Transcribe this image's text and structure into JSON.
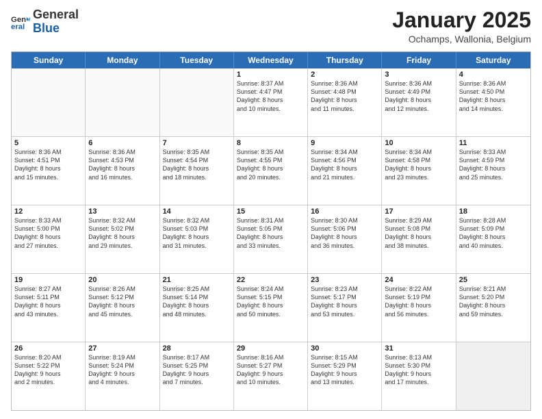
{
  "header": {
    "logo_general": "General",
    "logo_blue": "Blue",
    "month_title": "January 2025",
    "location": "Ochamps, Wallonia, Belgium"
  },
  "weekdays": [
    "Sunday",
    "Monday",
    "Tuesday",
    "Wednesday",
    "Thursday",
    "Friday",
    "Saturday"
  ],
  "rows": [
    [
      {
        "day": "",
        "text": "",
        "empty": true
      },
      {
        "day": "",
        "text": "",
        "empty": true
      },
      {
        "day": "",
        "text": "",
        "empty": true
      },
      {
        "day": "1",
        "text": "Sunrise: 8:37 AM\nSunset: 4:47 PM\nDaylight: 8 hours\nand 10 minutes.",
        "empty": false
      },
      {
        "day": "2",
        "text": "Sunrise: 8:36 AM\nSunset: 4:48 PM\nDaylight: 8 hours\nand 11 minutes.",
        "empty": false
      },
      {
        "day": "3",
        "text": "Sunrise: 8:36 AM\nSunset: 4:49 PM\nDaylight: 8 hours\nand 12 minutes.",
        "empty": false
      },
      {
        "day": "4",
        "text": "Sunrise: 8:36 AM\nSunset: 4:50 PM\nDaylight: 8 hours\nand 14 minutes.",
        "empty": false
      }
    ],
    [
      {
        "day": "5",
        "text": "Sunrise: 8:36 AM\nSunset: 4:51 PM\nDaylight: 8 hours\nand 15 minutes.",
        "empty": false
      },
      {
        "day": "6",
        "text": "Sunrise: 8:36 AM\nSunset: 4:53 PM\nDaylight: 8 hours\nand 16 minutes.",
        "empty": false
      },
      {
        "day": "7",
        "text": "Sunrise: 8:35 AM\nSunset: 4:54 PM\nDaylight: 8 hours\nand 18 minutes.",
        "empty": false
      },
      {
        "day": "8",
        "text": "Sunrise: 8:35 AM\nSunset: 4:55 PM\nDaylight: 8 hours\nand 20 minutes.",
        "empty": false
      },
      {
        "day": "9",
        "text": "Sunrise: 8:34 AM\nSunset: 4:56 PM\nDaylight: 8 hours\nand 21 minutes.",
        "empty": false
      },
      {
        "day": "10",
        "text": "Sunrise: 8:34 AM\nSunset: 4:58 PM\nDaylight: 8 hours\nand 23 minutes.",
        "empty": false
      },
      {
        "day": "11",
        "text": "Sunrise: 8:33 AM\nSunset: 4:59 PM\nDaylight: 8 hours\nand 25 minutes.",
        "empty": false
      }
    ],
    [
      {
        "day": "12",
        "text": "Sunrise: 8:33 AM\nSunset: 5:00 PM\nDaylight: 8 hours\nand 27 minutes.",
        "empty": false
      },
      {
        "day": "13",
        "text": "Sunrise: 8:32 AM\nSunset: 5:02 PM\nDaylight: 8 hours\nand 29 minutes.",
        "empty": false
      },
      {
        "day": "14",
        "text": "Sunrise: 8:32 AM\nSunset: 5:03 PM\nDaylight: 8 hours\nand 31 minutes.",
        "empty": false
      },
      {
        "day": "15",
        "text": "Sunrise: 8:31 AM\nSunset: 5:05 PM\nDaylight: 8 hours\nand 33 minutes.",
        "empty": false
      },
      {
        "day": "16",
        "text": "Sunrise: 8:30 AM\nSunset: 5:06 PM\nDaylight: 8 hours\nand 36 minutes.",
        "empty": false
      },
      {
        "day": "17",
        "text": "Sunrise: 8:29 AM\nSunset: 5:08 PM\nDaylight: 8 hours\nand 38 minutes.",
        "empty": false
      },
      {
        "day": "18",
        "text": "Sunrise: 8:28 AM\nSunset: 5:09 PM\nDaylight: 8 hours\nand 40 minutes.",
        "empty": false
      }
    ],
    [
      {
        "day": "19",
        "text": "Sunrise: 8:27 AM\nSunset: 5:11 PM\nDaylight: 8 hours\nand 43 minutes.",
        "empty": false
      },
      {
        "day": "20",
        "text": "Sunrise: 8:26 AM\nSunset: 5:12 PM\nDaylight: 8 hours\nand 45 minutes.",
        "empty": false
      },
      {
        "day": "21",
        "text": "Sunrise: 8:25 AM\nSunset: 5:14 PM\nDaylight: 8 hours\nand 48 minutes.",
        "empty": false
      },
      {
        "day": "22",
        "text": "Sunrise: 8:24 AM\nSunset: 5:15 PM\nDaylight: 8 hours\nand 50 minutes.",
        "empty": false
      },
      {
        "day": "23",
        "text": "Sunrise: 8:23 AM\nSunset: 5:17 PM\nDaylight: 8 hours\nand 53 minutes.",
        "empty": false
      },
      {
        "day": "24",
        "text": "Sunrise: 8:22 AM\nSunset: 5:19 PM\nDaylight: 8 hours\nand 56 minutes.",
        "empty": false
      },
      {
        "day": "25",
        "text": "Sunrise: 8:21 AM\nSunset: 5:20 PM\nDaylight: 8 hours\nand 59 minutes.",
        "empty": false
      }
    ],
    [
      {
        "day": "26",
        "text": "Sunrise: 8:20 AM\nSunset: 5:22 PM\nDaylight: 9 hours\nand 2 minutes.",
        "empty": false
      },
      {
        "day": "27",
        "text": "Sunrise: 8:19 AM\nSunset: 5:24 PM\nDaylight: 9 hours\nand 4 minutes.",
        "empty": false
      },
      {
        "day": "28",
        "text": "Sunrise: 8:17 AM\nSunset: 5:25 PM\nDaylight: 9 hours\nand 7 minutes.",
        "empty": false
      },
      {
        "day": "29",
        "text": "Sunrise: 8:16 AM\nSunset: 5:27 PM\nDaylight: 9 hours\nand 10 minutes.",
        "empty": false
      },
      {
        "day": "30",
        "text": "Sunrise: 8:15 AM\nSunset: 5:29 PM\nDaylight: 9 hours\nand 13 minutes.",
        "empty": false
      },
      {
        "day": "31",
        "text": "Sunrise: 8:13 AM\nSunset: 5:30 PM\nDaylight: 9 hours\nand 17 minutes.",
        "empty": false
      },
      {
        "day": "",
        "text": "",
        "empty": true,
        "shaded": true
      }
    ]
  ]
}
